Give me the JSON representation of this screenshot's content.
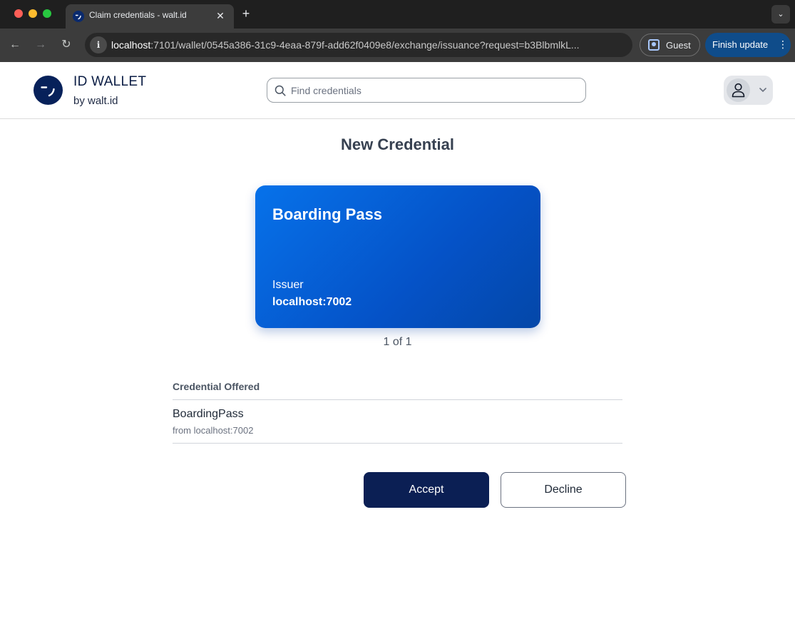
{
  "browser": {
    "tab_title": "Claim credentials - walt.id",
    "url_host": "localhost",
    "url_rest": ":7101/wallet/0545a386-31c9-4eaa-879f-add62f0409e8/exchange/issuance?request=b3BlbmlkL...",
    "guest_label": "Guest",
    "update_label": "Finish update"
  },
  "header": {
    "brand_title": "ID WALLET",
    "brand_subtitle": "by walt.id",
    "search_placeholder": "Find credentials"
  },
  "main": {
    "title": "New Credential",
    "card": {
      "title": "Boarding Pass",
      "issuer_label": "Issuer",
      "issuer_value": "localhost:7002"
    },
    "pager": "1 of 1",
    "offered": {
      "header": "Credential Offered",
      "items": [
        {
          "name": "BoardingPass",
          "from": "from localhost:7002"
        }
      ]
    },
    "actions": {
      "accept": "Accept",
      "decline": "Decline"
    }
  },
  "colors": {
    "brand_navy": "#07215a",
    "card_blue": "#0672ea",
    "accept_bg": "#0b1f54"
  },
  "icons": [
    "walt-id-logo-icon",
    "search-icon",
    "user-avatar-icon",
    "chevron-down-icon",
    "info-icon",
    "back-arrow-icon",
    "forward-arrow-icon",
    "reload-icon",
    "close-icon",
    "plus-icon",
    "guest-profile-icon",
    "more-vert-icon"
  ]
}
